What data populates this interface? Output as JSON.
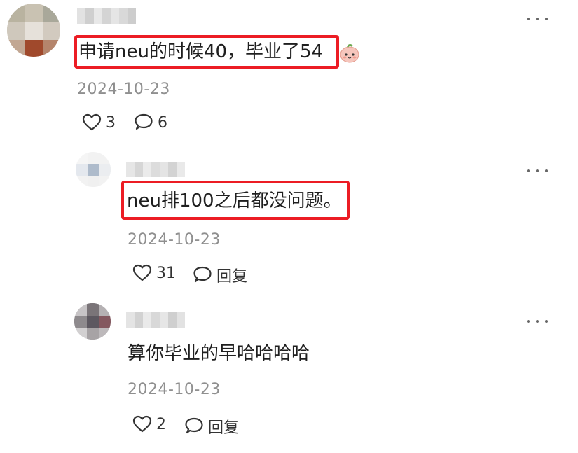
{
  "comments": [
    {
      "text": "申请neu的时候40，毕业了54",
      "emoji": "peach-face-emoji",
      "date": "2024-10-23",
      "likes": "3",
      "replies": "6"
    },
    {
      "text": "neu排100之后都没问题。",
      "date": "2024-10-23",
      "likes": "31",
      "reply_label": "回复"
    },
    {
      "text": "算你毕业的早哈哈哈哈",
      "date": "2024-10-23",
      "likes": "2",
      "reply_label": "回复"
    }
  ],
  "colors": {
    "highlight": "#ec1c24",
    "date": "#8f8f8f",
    "text": "#1f1f1f"
  }
}
